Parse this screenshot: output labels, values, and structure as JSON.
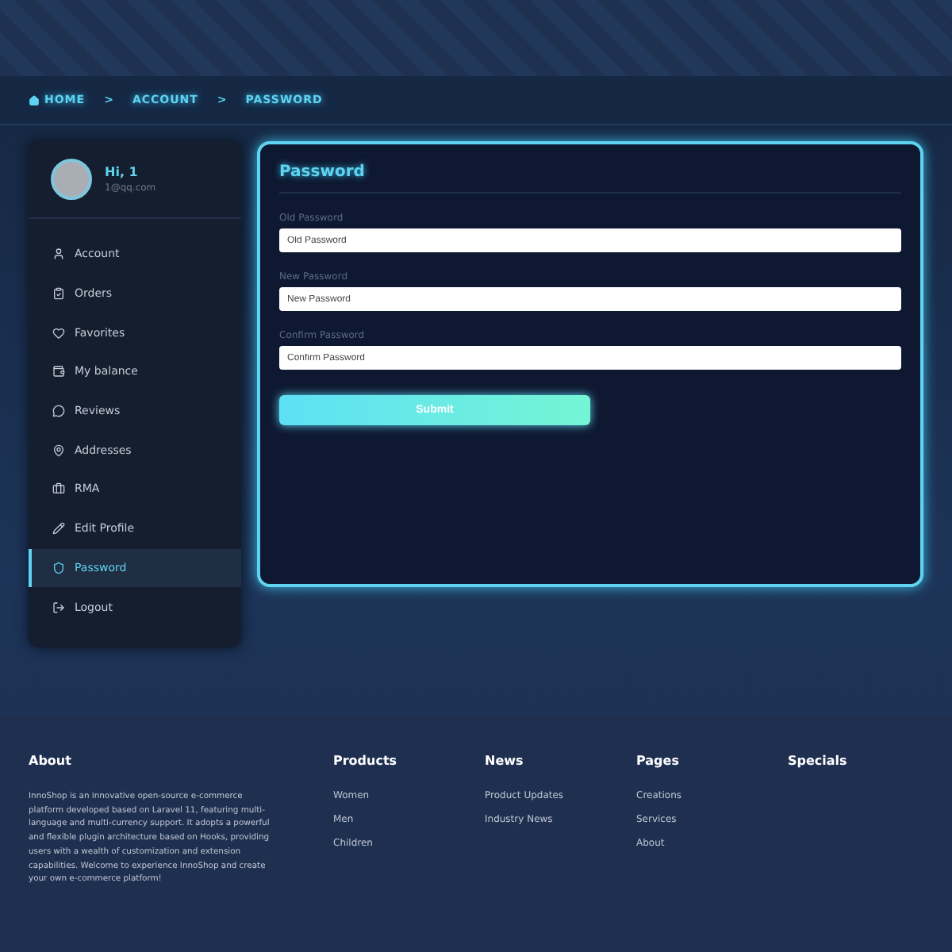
{
  "breadcrumb": {
    "separator": ">",
    "items": [
      {
        "label": "HOME",
        "kind": "home"
      },
      {
        "label": "ACCOUNT",
        "kind": "link"
      },
      {
        "label": "PASSWORD",
        "kind": "link"
      }
    ]
  },
  "profile": {
    "greeting": "Hi, 1",
    "email": "1@qq.com"
  },
  "menu": [
    {
      "label": "Account",
      "selected": false
    },
    {
      "label": "Orders",
      "selected": false
    },
    {
      "label": "Favorites",
      "selected": false
    },
    {
      "label": "My balance",
      "selected": false
    },
    {
      "label": "Reviews",
      "selected": false
    },
    {
      "label": "Addresses",
      "selected": false
    },
    {
      "label": "RMA",
      "selected": false
    },
    {
      "label": "Edit Profile",
      "selected": false
    },
    {
      "label": "Password",
      "selected": true
    },
    {
      "label": "Logout",
      "selected": false
    }
  ],
  "form": {
    "title": "Password",
    "fields": [
      {
        "label": "Old Password",
        "placeholder": "Old Password"
      },
      {
        "label": "New Password",
        "placeholder": "New Password"
      },
      {
        "label": "Confirm Password",
        "placeholder": "Confirm Password"
      }
    ],
    "submit": "Submit"
  },
  "footer": {
    "about": {
      "title": "About",
      "text": "InnoShop is an innovative open-source e-commerce platform developed based on Laravel 11, featuring multi-language and multi-currency support. It adopts a powerful and flexible plugin architecture based on Hooks, providing users with a wealth of customization and extension capabilities. Welcome to experience InnoShop and create your own e-commerce platform!"
    },
    "columns": [
      {
        "title": "Products",
        "links": [
          "Women",
          "Men",
          "Children"
        ]
      },
      {
        "title": "News",
        "links": [
          "Product Updates",
          "Industry News"
        ]
      },
      {
        "title": "Pages",
        "links": [
          "Creations",
          "Services",
          "About"
        ]
      },
      {
        "title": "Specials"
      }
    ]
  }
}
